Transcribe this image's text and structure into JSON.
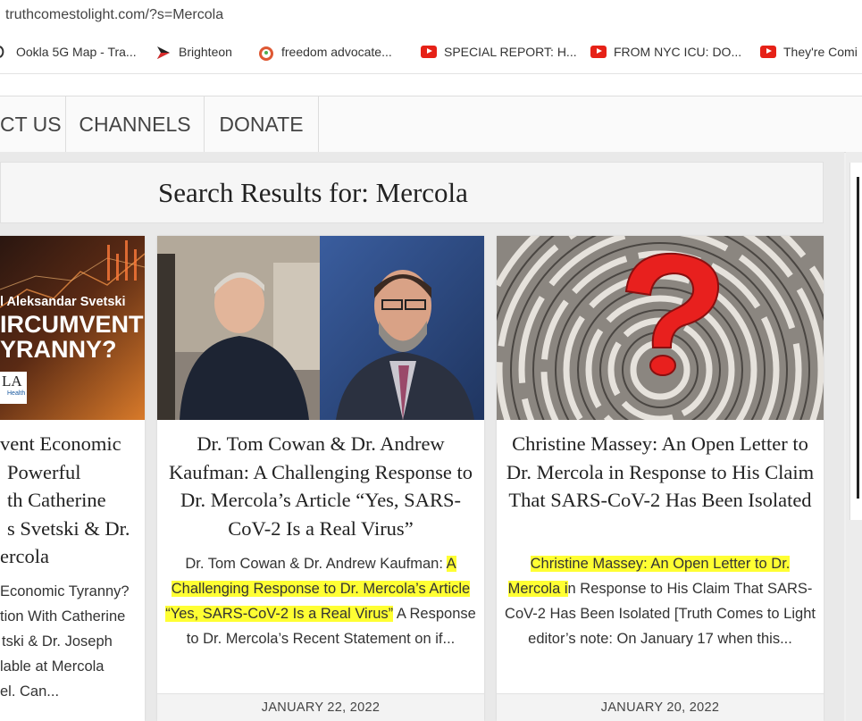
{
  "browser": {
    "url": "truthcomestolight.com/?s=Mercola",
    "bookmarks": [
      {
        "label": "Ookla 5G Map - Tra...",
        "icon": "ookla-icon"
      },
      {
        "label": "Brighteon",
        "icon": "brighteon-icon"
      },
      {
        "label": "freedom advocate...",
        "icon": "duckduckgo-icon"
      },
      {
        "label": "SPECIAL REPORT: H...",
        "icon": "youtube-icon"
      },
      {
        "label": "FROM NYC ICU: DO...",
        "icon": "youtube-icon"
      },
      {
        "label": "They're Comi",
        "icon": "youtube-icon"
      }
    ]
  },
  "nav": {
    "items": [
      "CT US",
      "CHANNELS",
      "DONATE"
    ]
  },
  "search": {
    "title": "Search Results for: Mercola"
  },
  "cards": [
    {
      "image_text": {
        "line1": "l Aleksandar Svetski",
        "line2": "IRCUMVENT",
        "line3": "YRANNY?",
        "logo": "LA",
        "logo_sub": "Health"
      },
      "title_lines": [
        "vent Economic",
        "Powerful",
        "th Catherine",
        "s Svetski & Dr.",
        "ercola"
      ],
      "excerpt_lines": [
        "Economic Tyranny?",
        "tion With Catherine",
        "tski & Dr. Joseph",
        "lable at Mercola",
        "el.   Can..."
      ]
    },
    {
      "title": "Dr. Tom Cowan & Dr. Andrew Kaufman: A Challenging Response to Dr. Mercola’s Article “Yes, SARS-CoV-2 Is a Real Virus”",
      "excerpt_plain_before": "Dr. Tom Cowan & Dr. Andrew Kaufman: ",
      "excerpt_highlight": "A Challenging Response to Dr. Mercola’s Article “Yes, SARS-CoV-2 Is a Real Virus”",
      "excerpt_plain_after": "  A Response to Dr. Mercola’s Recent Statement on if...",
      "date": "JANUARY 22, 2022"
    },
    {
      "title": "Christine Massey: An Open Letter to Dr. Mercola in Response to His Claim That SARS-CoV-2 Has Been Isolated",
      "excerpt_highlight": "Christine Massey: An Open Letter to Dr. Mercola i",
      "excerpt_plain_after": "n Response to His Claim That SARS-CoV-2 Has Been Isolated    [Truth Comes to Light editor’s note: On January 17 when this...",
      "date": "JANUARY 20, 2022"
    }
  ],
  "colors": {
    "highlight": "#ffff33",
    "youtube_red": "#e62117",
    "question_mark": "#e8201e"
  }
}
